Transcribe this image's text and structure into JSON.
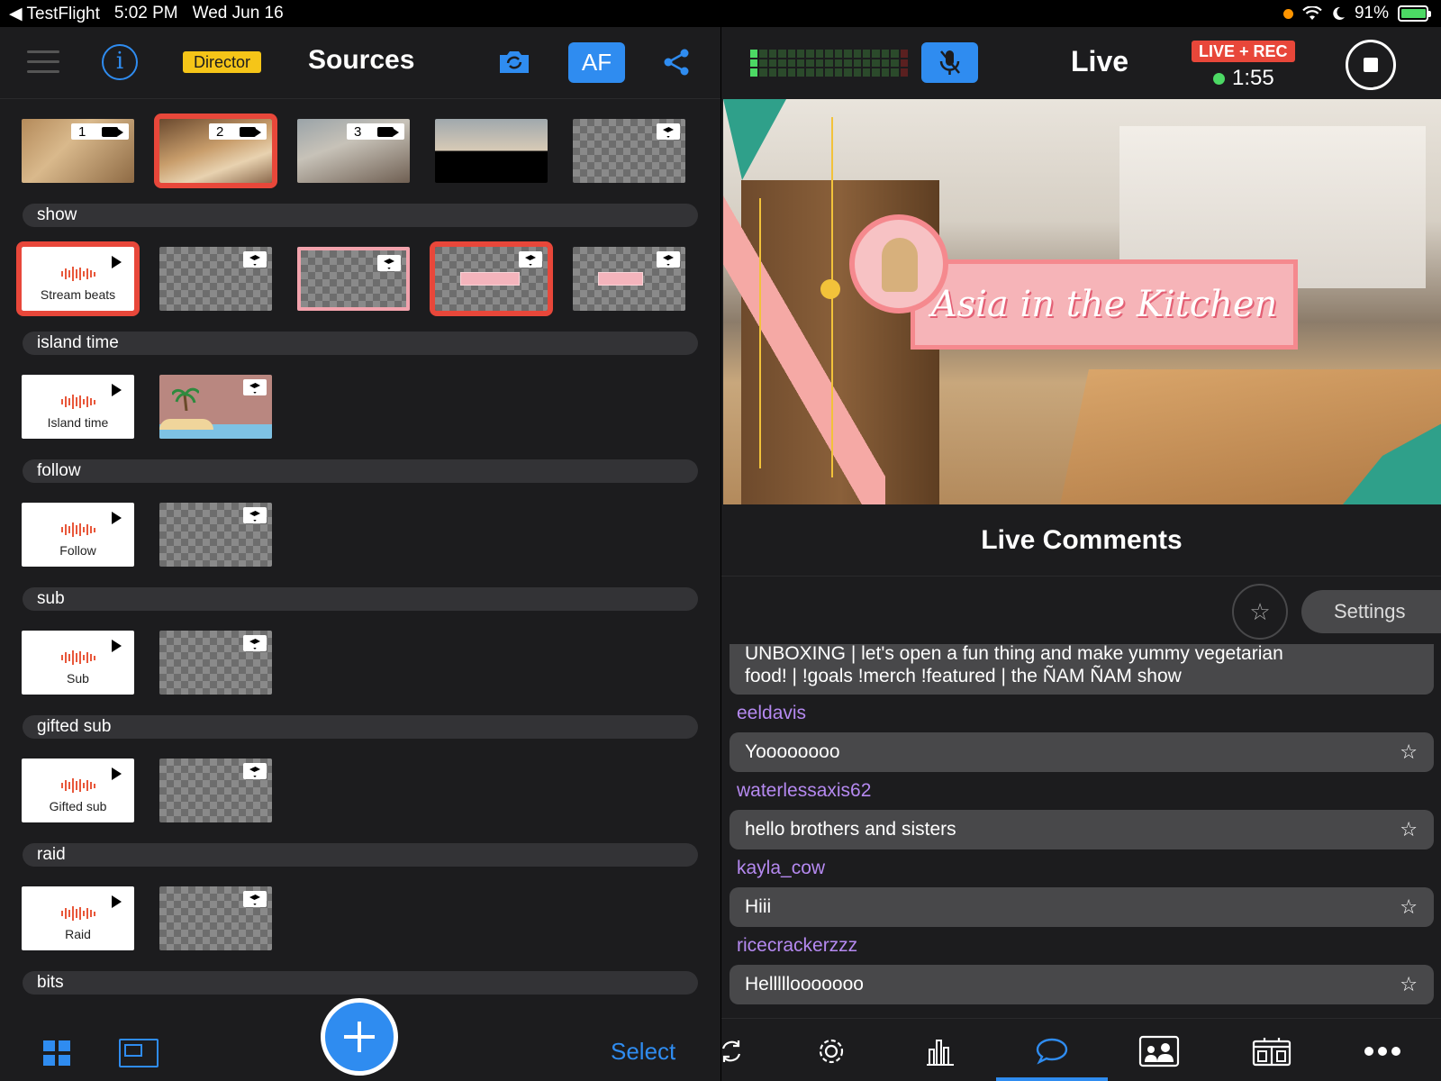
{
  "statusbar": {
    "back_app": "◀ TestFlight",
    "time": "5:02 PM",
    "date": "Wed Jun 16",
    "battery": "91%",
    "battery_level": 0.91
  },
  "left": {
    "director_badge": "Director",
    "title": "Sources",
    "af_label": "AF",
    "cameras": [
      {
        "num": "1",
        "selected": false
      },
      {
        "num": "2",
        "selected": true
      },
      {
        "num": "3",
        "selected": false
      },
      {
        "num": "",
        "selected": false
      },
      {
        "num": "",
        "selected": false
      }
    ],
    "sections": [
      {
        "label": "show",
        "sound_label": "Stream beats"
      },
      {
        "label": "island time",
        "sound_label": "Island time"
      },
      {
        "label": "follow",
        "sound_label": "Follow"
      },
      {
        "label": "sub",
        "sound_label": "Sub"
      },
      {
        "label": "gifted sub",
        "sound_label": "Gifted sub"
      },
      {
        "label": "raid",
        "sound_label": "Raid"
      },
      {
        "label": "bits",
        "sound_label": ""
      }
    ],
    "select_label": "Select"
  },
  "right": {
    "live_title": "Live",
    "live_rec_badge": "LIVE + REC",
    "timer": "1:55",
    "preview_title": "Asia in the Kitchen",
    "comments_title": "Live Comments",
    "settings_label": "Settings",
    "comments": [
      {
        "user": "",
        "text_line1": "UNBOXING | let's open a fun thing and make yummy vegetarian",
        "text_line2": "food! | !goals !merch !featured | the ÑAM ÑAM show"
      },
      {
        "user": "eeldavis",
        "text": "Yoooooooo"
      },
      {
        "user": "waterlessaxis62",
        "text": "hello brothers and sisters"
      },
      {
        "user": "kayla_cow",
        "text": "Hiii"
      },
      {
        "user": "ricecrackerzzz",
        "text": "Helllllooooooo"
      }
    ],
    "star_glyph": "☆",
    "star_outline_glyph": "☆"
  },
  "colors": {
    "accent": "#2f8cf0",
    "selected_outline": "#e8473a",
    "username": "#b589f0",
    "director": "#f5c518"
  }
}
